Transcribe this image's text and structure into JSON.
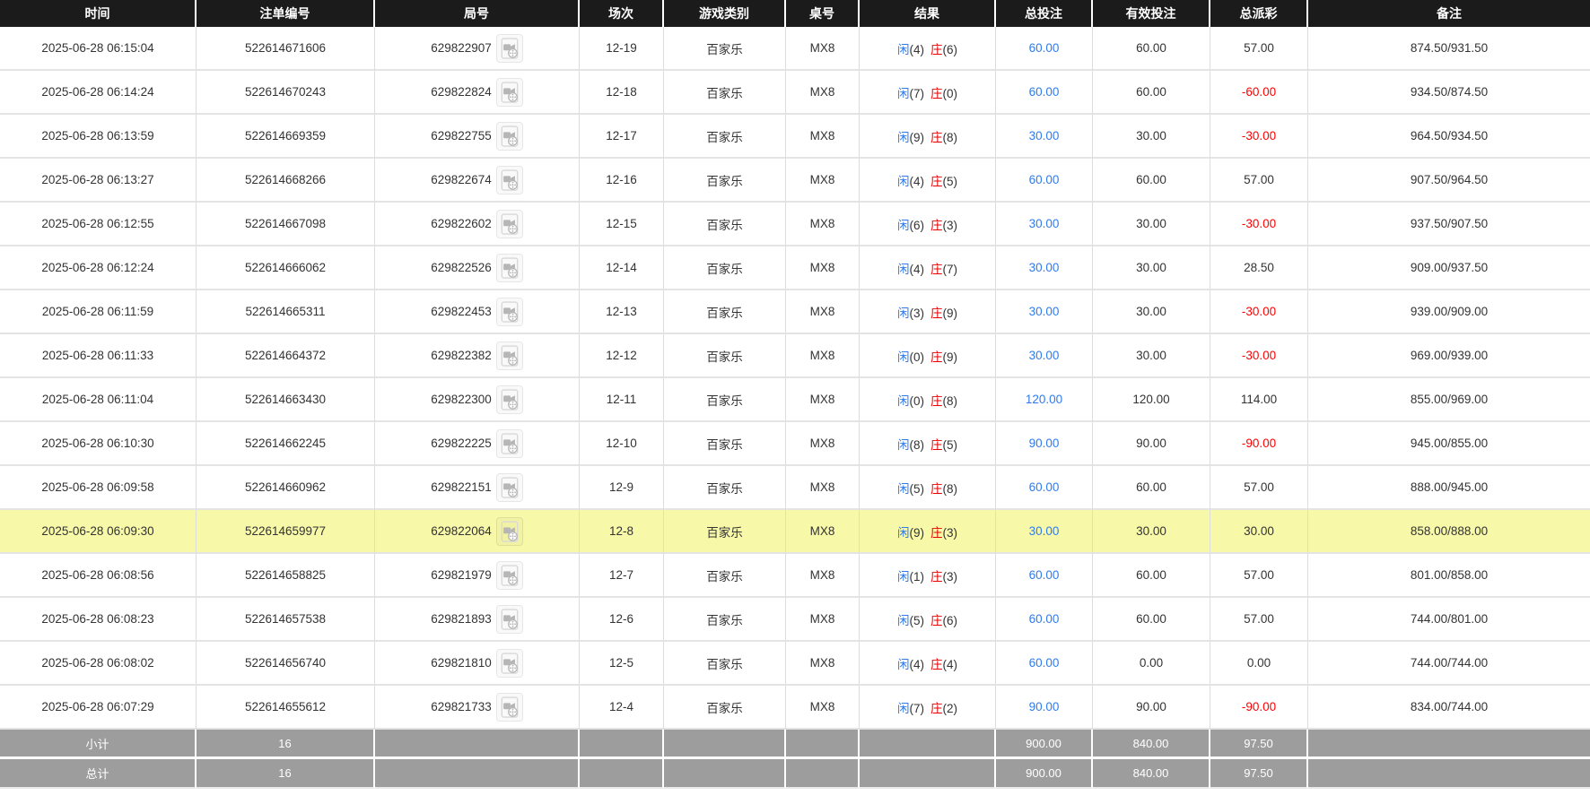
{
  "table": {
    "columns": [
      "时间",
      "注单编号",
      "局号",
      "场次",
      "游戏类别",
      "桌号",
      "结果",
      "总投注",
      "有效投注",
      "总派彩",
      "备注"
    ],
    "result_labels": {
      "player": "闲",
      "banker": "庄"
    },
    "icons": {
      "video_replay_icon": "video-file-with-film-reel"
    },
    "rows": [
      {
        "time": "2025-06-28 06:15:04",
        "order_no": "522614671606",
        "game_no": "629822907",
        "session": "12-19",
        "game_type": "百家乐",
        "table_no": "MX8",
        "result": {
          "player": 4,
          "banker": 6
        },
        "total_bet": "60.00",
        "valid_bet": "60.00",
        "payout": "57.00",
        "remark": "874.50/931.50",
        "highlighted": false
      },
      {
        "time": "2025-06-28 06:14:24",
        "order_no": "522614670243",
        "game_no": "629822824",
        "session": "12-18",
        "game_type": "百家乐",
        "table_no": "MX8",
        "result": {
          "player": 7,
          "banker": 0
        },
        "total_bet": "60.00",
        "valid_bet": "60.00",
        "payout": "-60.00",
        "remark": "934.50/874.50",
        "highlighted": false
      },
      {
        "time": "2025-06-28 06:13:59",
        "order_no": "522614669359",
        "game_no": "629822755",
        "session": "12-17",
        "game_type": "百家乐",
        "table_no": "MX8",
        "result": {
          "player": 9,
          "banker": 8
        },
        "total_bet": "30.00",
        "valid_bet": "30.00",
        "payout": "-30.00",
        "remark": "964.50/934.50",
        "highlighted": false
      },
      {
        "time": "2025-06-28 06:13:27",
        "order_no": "522614668266",
        "game_no": "629822674",
        "session": "12-16",
        "game_type": "百家乐",
        "table_no": "MX8",
        "result": {
          "player": 4,
          "banker": 5
        },
        "total_bet": "60.00",
        "valid_bet": "60.00",
        "payout": "57.00",
        "remark": "907.50/964.50",
        "highlighted": false
      },
      {
        "time": "2025-06-28 06:12:55",
        "order_no": "522614667098",
        "game_no": "629822602",
        "session": "12-15",
        "game_type": "百家乐",
        "table_no": "MX8",
        "result": {
          "player": 6,
          "banker": 3
        },
        "total_bet": "30.00",
        "valid_bet": "30.00",
        "payout": "-30.00",
        "remark": "937.50/907.50",
        "highlighted": false
      },
      {
        "time": "2025-06-28 06:12:24",
        "order_no": "522614666062",
        "game_no": "629822526",
        "session": "12-14",
        "game_type": "百家乐",
        "table_no": "MX8",
        "result": {
          "player": 4,
          "banker": 7
        },
        "total_bet": "30.00",
        "valid_bet": "30.00",
        "payout": "28.50",
        "remark": "909.00/937.50",
        "highlighted": false
      },
      {
        "time": "2025-06-28 06:11:59",
        "order_no": "522614665311",
        "game_no": "629822453",
        "session": "12-13",
        "game_type": "百家乐",
        "table_no": "MX8",
        "result": {
          "player": 3,
          "banker": 9
        },
        "total_bet": "30.00",
        "valid_bet": "30.00",
        "payout": "-30.00",
        "remark": "939.00/909.00",
        "highlighted": false
      },
      {
        "time": "2025-06-28 06:11:33",
        "order_no": "522614664372",
        "game_no": "629822382",
        "session": "12-12",
        "game_type": "百家乐",
        "table_no": "MX8",
        "result": {
          "player": 0,
          "banker": 9
        },
        "total_bet": "30.00",
        "valid_bet": "30.00",
        "payout": "-30.00",
        "remark": "969.00/939.00",
        "highlighted": false
      },
      {
        "time": "2025-06-28 06:11:04",
        "order_no": "522614663430",
        "game_no": "629822300",
        "session": "12-11",
        "game_type": "百家乐",
        "table_no": "MX8",
        "result": {
          "player": 0,
          "banker": 8
        },
        "total_bet": "120.00",
        "valid_bet": "120.00",
        "payout": "114.00",
        "remark": "855.00/969.00",
        "highlighted": false
      },
      {
        "time": "2025-06-28 06:10:30",
        "order_no": "522614662245",
        "game_no": "629822225",
        "session": "12-10",
        "game_type": "百家乐",
        "table_no": "MX8",
        "result": {
          "player": 8,
          "banker": 5
        },
        "total_bet": "90.00",
        "valid_bet": "90.00",
        "payout": "-90.00",
        "remark": "945.00/855.00",
        "highlighted": false
      },
      {
        "time": "2025-06-28 06:09:58",
        "order_no": "522614660962",
        "game_no": "629822151",
        "session": "12-9",
        "game_type": "百家乐",
        "table_no": "MX8",
        "result": {
          "player": 5,
          "banker": 8
        },
        "total_bet": "60.00",
        "valid_bet": "60.00",
        "payout": "57.00",
        "remark": "888.00/945.00",
        "highlighted": false
      },
      {
        "time": "2025-06-28 06:09:30",
        "order_no": "522614659977",
        "game_no": "629822064",
        "session": "12-8",
        "game_type": "百家乐",
        "table_no": "MX8",
        "result": {
          "player": 9,
          "banker": 3
        },
        "total_bet": "30.00",
        "valid_bet": "30.00",
        "payout": "30.00",
        "remark": "858.00/888.00",
        "highlighted": true
      },
      {
        "time": "2025-06-28 06:08:56",
        "order_no": "522614658825",
        "game_no": "629821979",
        "session": "12-7",
        "game_type": "百家乐",
        "table_no": "MX8",
        "result": {
          "player": 1,
          "banker": 3
        },
        "total_bet": "60.00",
        "valid_bet": "60.00",
        "payout": "57.00",
        "remark": "801.00/858.00",
        "highlighted": false
      },
      {
        "time": "2025-06-28 06:08:23",
        "order_no": "522614657538",
        "game_no": "629821893",
        "session": "12-6",
        "game_type": "百家乐",
        "table_no": "MX8",
        "result": {
          "player": 5,
          "banker": 6
        },
        "total_bet": "60.00",
        "valid_bet": "60.00",
        "payout": "57.00",
        "remark": "744.00/801.00",
        "highlighted": false
      },
      {
        "time": "2025-06-28 06:08:02",
        "order_no": "522614656740",
        "game_no": "629821810",
        "session": "12-5",
        "game_type": "百家乐",
        "table_no": "MX8",
        "result": {
          "player": 4,
          "banker": 4
        },
        "total_bet": "60.00",
        "valid_bet": "0.00",
        "payout": "0.00",
        "remark": "744.00/744.00",
        "highlighted": false
      },
      {
        "time": "2025-06-28 06:07:29",
        "order_no": "522614655612",
        "game_no": "629821733",
        "session": "12-4",
        "game_type": "百家乐",
        "table_no": "MX8",
        "result": {
          "player": 7,
          "banker": 2
        },
        "total_bet": "90.00",
        "valid_bet": "90.00",
        "payout": "-90.00",
        "remark": "834.00/744.00",
        "highlighted": false
      }
    ]
  },
  "footer": {
    "rows": [
      {
        "label": "小计",
        "count": "16",
        "total_bet": "900.00",
        "valid_bet": "840.00",
        "payout": "97.50"
      },
      {
        "label": "总计",
        "count": "16",
        "total_bet": "900.00",
        "valid_bet": "840.00",
        "payout": "97.50"
      }
    ]
  },
  "colors": {
    "header_bg": "#1b1b1b",
    "highlight_row": "#f7f8a8",
    "footer_bg": "#9d9d9d",
    "bet_blue": "#2f7bee",
    "negative_red": "#ff0000",
    "banker_red": "#e60000"
  }
}
